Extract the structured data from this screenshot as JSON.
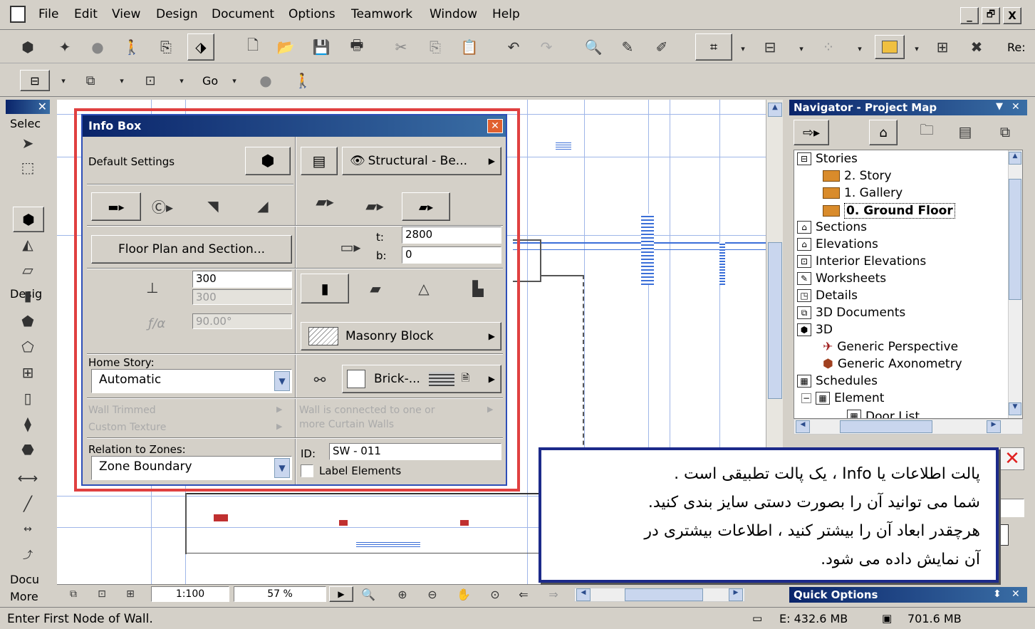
{
  "menubar": {
    "items": [
      "File",
      "Edit",
      "View",
      "Design",
      "Document",
      "Options",
      "Teamwork",
      "Window",
      "Help"
    ],
    "window_controls": [
      "_",
      "🗗",
      "X"
    ]
  },
  "toolbar2": {
    "go_label": "Go"
  },
  "toolbar1": {
    "right_cut_label": "Re:"
  },
  "toolbox": {
    "select_label": "Selec",
    "design_label": "Desig",
    "docu_label": "Docu",
    "more_label": "More"
  },
  "info_box": {
    "title": "Info Box",
    "default_settings_label": "Default Settings",
    "structural_label": "Structural - Be...",
    "floor_plan_button": "Floor Plan and Section...",
    "t_label": "t:",
    "t_value": "2800",
    "b_label": "b:",
    "b_value": "0",
    "height_value": "300",
    "height2_value": "300",
    "angle_value": "90.00°",
    "angle_symbol": "ƒ/α",
    "masonry_label": "Masonry Block",
    "home_story_label": "Home Story:",
    "home_story_value": "Automatic",
    "brick_label": "Brick-...",
    "wall_trimmed_label": "Wall Trimmed",
    "custom_texture_label": "Custom Texture",
    "curtain_note_line1": "Wall is connected to one or",
    "curtain_note_line2": "more Curtain Walls",
    "relation_label": "Relation to Zones:",
    "relation_value": "Zone Boundary",
    "id_label": "ID:",
    "id_value": "SW - 011",
    "label_elements": "Label Elements"
  },
  "navigator": {
    "title": "Navigator - Project Map",
    "items": [
      {
        "label": "Stories",
        "level": 0,
        "icon": "stories-icon"
      },
      {
        "label": "2. Story",
        "level": 1,
        "icon": "story-folder-icon"
      },
      {
        "label": "1. Gallery",
        "level": 1,
        "icon": "story-folder-icon"
      },
      {
        "label": "0. Ground Floor",
        "level": 1,
        "icon": "story-folder-icon",
        "selected": true
      },
      {
        "label": "Sections",
        "level": 0,
        "icon": "sections-icon"
      },
      {
        "label": "Elevations",
        "level": 0,
        "icon": "elevations-icon"
      },
      {
        "label": "Interior Elevations",
        "level": 0,
        "icon": "interior-elevations-icon"
      },
      {
        "label": "Worksheets",
        "level": 0,
        "icon": "worksheets-icon"
      },
      {
        "label": "Details",
        "level": 0,
        "icon": "details-icon"
      },
      {
        "label": "3D Documents",
        "level": 0,
        "icon": "3d-documents-icon"
      },
      {
        "label": "3D",
        "level": 0,
        "icon": "3d-icon"
      },
      {
        "label": "Generic Perspective",
        "level": 1,
        "icon": "camera-icon"
      },
      {
        "label": "Generic Axonometry",
        "level": 1,
        "icon": "axonometry-icon"
      },
      {
        "label": "Schedules",
        "level": 0,
        "icon": "schedules-icon"
      },
      {
        "label": "Element",
        "level": 1,
        "icon": "element-icon"
      }
    ],
    "partial_item": "Door List"
  },
  "quick_options": {
    "title": "Quick Options"
  },
  "view_bar": {
    "scale": "1:100",
    "zoom": "57 %"
  },
  "callout": {
    "lines": [
      "پالت اطلاعات یا Info ، یک پالت تطبیقی است .",
      "شما می توانید آن را بصورت دستی سایز بندی کنید.",
      "هرچقدر ابعاد آن را بیشتر کنید ، اطلاعات بیشتری در",
      "آن نمایش داده می شود."
    ]
  },
  "status_bar": {
    "message": "Enter First Node of Wall.",
    "disk": "E: 432.6 MB",
    "memory": "701.6 MB"
  },
  "colors": {
    "title_blue": "#0a246a",
    "highlight_red": "#e04040",
    "callout_border": "#1c2a8a"
  }
}
